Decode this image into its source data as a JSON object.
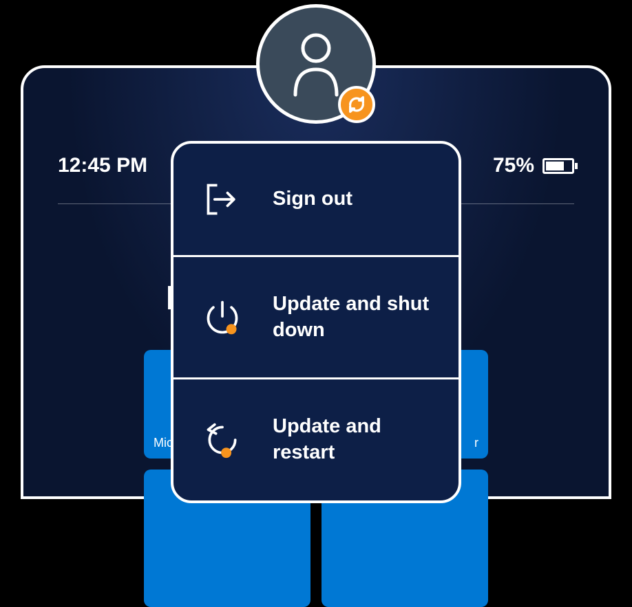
{
  "statusBar": {
    "time": "12:45 PM",
    "batteryPercent": "75%"
  },
  "tiles": {
    "left": "Mic",
    "right": "r"
  },
  "powerMenu": {
    "signOut": "Sign out",
    "updateShutdown": "Update and shut down",
    "updateRestart": "Update and restart"
  },
  "colors": {
    "accent": "#f7941e",
    "tile": "#0078d4"
  }
}
